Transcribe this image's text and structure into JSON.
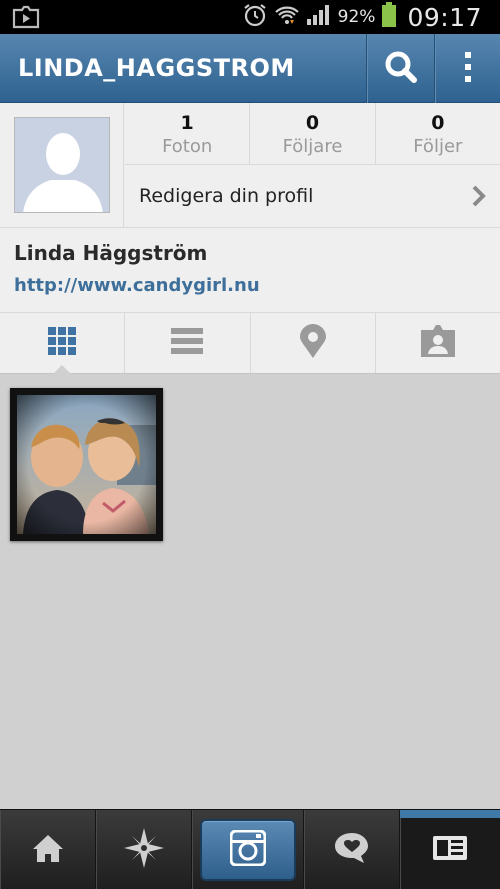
{
  "status_bar": {
    "battery_percent": "92%",
    "time": "09:17",
    "battery_color": "#8bc34a"
  },
  "action_bar": {
    "title": "LINDA_HAGGSTROM",
    "background_color": "#3f72a0"
  },
  "profile": {
    "stats": [
      {
        "count": "1",
        "label": "Foton"
      },
      {
        "count": "0",
        "label": "Följare"
      },
      {
        "count": "0",
        "label": "Följer"
      }
    ],
    "edit_profile_label": "Redigera din profil",
    "full_name": "Linda Häggström",
    "website": "http://www.candygirl.nu",
    "link_color": "#3d6f9a"
  },
  "view_tabs": [
    {
      "icon": "grid-icon",
      "selected": true
    },
    {
      "icon": "list-icon",
      "selected": false
    },
    {
      "icon": "map-pin-icon",
      "selected": false
    },
    {
      "icon": "tagged-photos-icon",
      "selected": false
    }
  ],
  "photos": [
    {
      "subject": "photo-thumbnail"
    }
  ],
  "bottom_nav": [
    {
      "icon": "home-icon",
      "active": false
    },
    {
      "icon": "explore-icon",
      "active": false
    },
    {
      "icon": "camera-icon",
      "active": false
    },
    {
      "icon": "news-icon",
      "active": false
    },
    {
      "icon": "profile-icon",
      "active": true
    }
  ]
}
